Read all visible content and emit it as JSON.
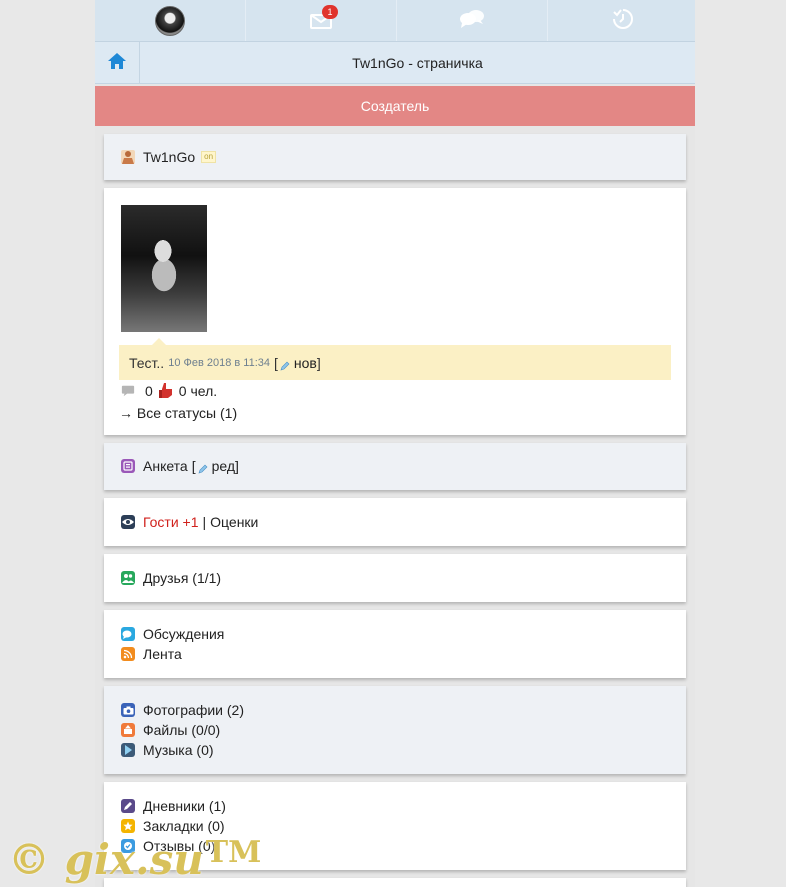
{
  "topbar": {
    "mail_badge": "1"
  },
  "header": {
    "title": "Tw1nGo - страничка"
  },
  "creator_banner": "Создатель",
  "profile": {
    "username": "Tw1nGo",
    "online": "on"
  },
  "status": {
    "text": "Тест..",
    "date": "10 Фев 2018 в 11:34",
    "bracket_open": "[",
    "edit_label": "нов",
    "bracket_close": "]",
    "comments_count": "0",
    "likes_count": "0 чел.",
    "all_statuses": "→ Все статусы (1)"
  },
  "anketa": {
    "label": "Анкета",
    "bracket_open": "[",
    "edit_label": "ред",
    "bracket_close": "]"
  },
  "guests": {
    "label": "Гости +1",
    "separator": "|",
    "ratings": "Оценки"
  },
  "friends": {
    "label": "Друзья (1/1)"
  },
  "social": {
    "discussions": "Обсуждения",
    "feed": "Лента"
  },
  "media": {
    "photos": "Фотографии (2)",
    "files": "Файлы (0/0)",
    "music": "Музыка (0)"
  },
  "misc": {
    "diaries": "Дневники (1)",
    "bookmarks": "Закладки (0)",
    "reviews": "Отзывы (0)"
  },
  "watermark": {
    "text": "© gix.su",
    "tm": "TM"
  },
  "colors": {
    "creator_bg": "#e38785",
    "topbar_bg": "#d6e4ef",
    "guest_red": "#d0211c",
    "status_bg": "#fbf0c5"
  },
  "icons": {
    "top": [
      "avatar",
      "mail-icon",
      "chat-bubbles-icon",
      "clock-check-icon"
    ],
    "header": "home-icon"
  }
}
